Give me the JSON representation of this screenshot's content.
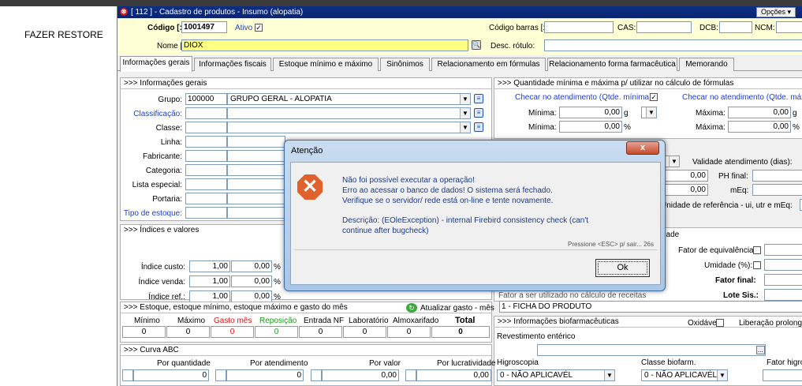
{
  "note": "FAZER RESTORE",
  "window": {
    "title": "[ 112 ] - Cadastro de produtos - Insumo (alopatia)",
    "options_label": "Opções ▾"
  },
  "header": {
    "codigo_label": "Código [:",
    "codigo_value": "1001497",
    "ativo_label": "Ativo",
    "ativo_checked": "✓",
    "codigo_barras_label": "Código barras [:",
    "cas_label": "CAS:",
    "dcb_label": "DCB:",
    "ncm_label": "NCM:",
    "nome_label": "Nome [:",
    "nome_value": "DIOX",
    "desc_rotulo_label": "Desc. rótulo:"
  },
  "tabs": [
    "Informações gerais",
    "Informações fiscais",
    "Estoque mínimo e máximo",
    "Sinônimos",
    "Relacionamento em fórmulas",
    "Relacionamento forma farmacêutica",
    "Memorando"
  ],
  "info_gerais": {
    "title": ">>> Informações gerais",
    "grupo_label": "Grupo:",
    "grupo_code": "100000",
    "grupo_name": "GRUPO GERAL - ALOPATIA",
    "classificacao_label": "Classificação:",
    "classe_label": "Classe:",
    "linha_label": "Linha:",
    "fabricante_label": "Fabricante:",
    "categoria_label": "Categoria:",
    "lista_especial_label": "Lista especial:",
    "portaria_label": "Portaria:",
    "tipo_estoque_label": "Tipo de estoque:"
  },
  "qtd_formulas": {
    "title": ">>> Quantidade mínima e máxima p/ utilizar no cálculo de fórmulas",
    "checar_min": "Checar no atendimento (Qtde. mínima)",
    "checar_max": "Checar no atendimento (Qtde. máxi",
    "minima_label": "Mínima:",
    "minima_value": "0,00",
    "minima_unit": "g",
    "minima2_value": "0,00",
    "minima2_unit": "%",
    "maxima_label": "Máxima:",
    "maxima_value": "0,00",
    "maxima_unit": "g",
    "maxima2_value": "0,00",
    "maxima2_unit": "%"
  },
  "validade": {
    "label": "Validade atendimento (dias):",
    "ph_final_label": "PH final:",
    "meq_label": "mEq:",
    "val1": "0,00",
    "val2": "0,00",
    "unidade_ref_label": "Unidade de referência - ui, utr e mEq:"
  },
  "indices": {
    "title": ">>> Índices e valores",
    "custo_label": "Índice custo:",
    "custo_value": "1,00",
    "custo_pct": "0,00",
    "venda_label": "Índice venda:",
    "venda_value": "1,00",
    "venda_pct": "0,00",
    "ref_label": "Índice ref.:",
    "ref_value": "1,00",
    "ref_pct": "0,00",
    "pct": "%"
  },
  "fatores": {
    "title": "dade",
    "equivalencia_label": "Fator de equivalência:",
    "umidade_label": "Umidade (%):",
    "fator_final_label": "Fator final:",
    "lote_sis_label": "Lote Sis.:",
    "fator_calc_label": "Fator a ser utilizado no cálculo de receitas"
  },
  "estoque": {
    "title": ">>> Estoque, estoque mínimo, estoque máximo e gasto do mês",
    "atualizar_label": "Atualizar gasto - mês",
    "columns": [
      "Mínimo",
      "Máximo",
      "Gasto mês",
      "Reposição",
      "Entrada NF",
      "Laboratório",
      "Almoxarifado",
      "Total"
    ],
    "values": [
      "0",
      "0",
      "0",
      "0",
      "0",
      "0",
      "0",
      "0"
    ]
  },
  "ficha": {
    "value": "1 - FICHA DO PRODUTO"
  },
  "biofarm": {
    "title": ">>> Informações biofarmacêuticas",
    "oxidavel_label": "Oxidável",
    "liberacao_label": "Liberação prolonga",
    "revestimento_label": "Revestimento entérico",
    "higroscopia_label": "Higroscopia",
    "higroscopia_value": "0 - NÃO APLICAVÉL",
    "classe_label": "Classe biofarm.",
    "classe_value": "0 - NÃO APLICAVÉL",
    "fator_higro_label": "Fator higro"
  },
  "curva": {
    "title": ">>> Curva ABC",
    "quantidade_label": "Por quantidade",
    "quantidade_value": "0",
    "atendimento_label": "Por atendimento",
    "atendimento_value": "0",
    "valor_label": "Por valor",
    "valor_value": "0,00",
    "lucratividade_label": "Por lucratividade",
    "lucratividade_value": "0,00"
  },
  "dialog": {
    "title": "Atenção",
    "close": "x",
    "line1": "Não foi possível executar a operação!",
    "line2": "Erro ao acessar o banco de dados! O sistema será fechado.",
    "line3": "Verifique se o servidor/ rede está on-line e tente novamente.",
    "line4": "Descrição: (EOleException) - internal Firebird consistency check (can't",
    "line5": "continue after bugcheck)",
    "hint": "Pressione <ESC> p/ sair... 26s",
    "ok_label": "Ok"
  }
}
